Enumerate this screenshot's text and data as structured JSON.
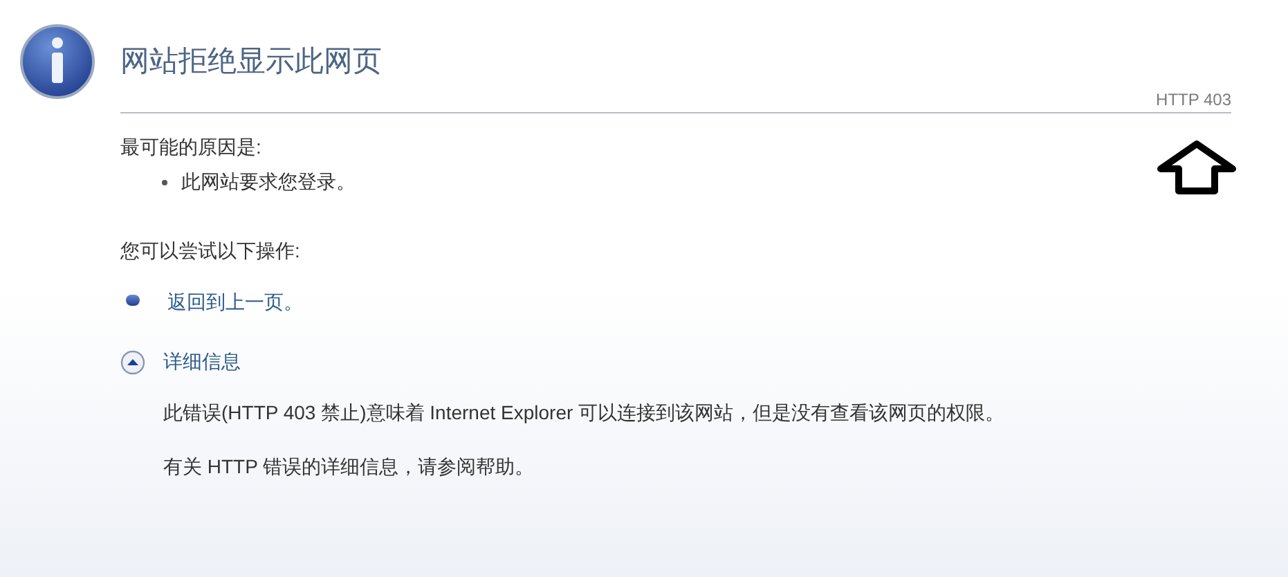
{
  "title": "网站拒绝显示此网页",
  "error_code": "HTTP 403",
  "reasons": {
    "heading": "最可能的原因是:",
    "items": [
      "此网站要求您登录。"
    ]
  },
  "actions": {
    "heading": "您可以尝试以下操作:",
    "links": [
      "返回到上一页。"
    ]
  },
  "details": {
    "label": "详细信息",
    "expanded": true,
    "paragraphs": [
      "此错误(HTTP 403 禁止)意味着 Internet Explorer 可以连接到该网站，但是没有查看该网页的权限。",
      "有关 HTTP 错误的详细信息，请参阅帮助。"
    ]
  }
}
